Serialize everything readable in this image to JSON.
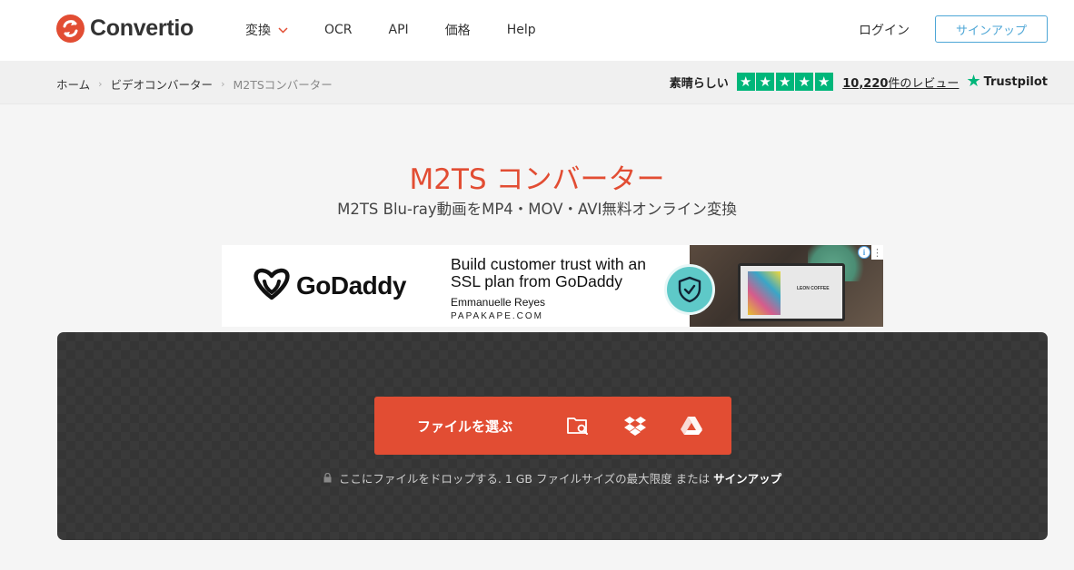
{
  "header": {
    "logo_text": "Convertio",
    "nav": [
      {
        "label": "変換",
        "has_dropdown": true
      },
      {
        "label": "OCR"
      },
      {
        "label": "API"
      },
      {
        "label": "価格"
      },
      {
        "label": "Help"
      }
    ],
    "login": "ログイン",
    "signup": "サインアップ"
  },
  "breadcrumb": {
    "items": [
      "ホーム",
      "ビデオコンバーター",
      "M2TSコンバーター"
    ],
    "separator": "›"
  },
  "trustpilot": {
    "label": "素晴らしい",
    "rating_stars": 5,
    "reviews_count": "10,220",
    "reviews_suffix": "件のレビュー",
    "brand": "Trustpilot",
    "star_color": "#00b67a"
  },
  "main": {
    "title": "M2TS コンバーター",
    "subtitle": "M2TS Blu-ray動画をMP4・MOV・AVI無料オンライン変換"
  },
  "ad": {
    "brand": "GoDaddy",
    "headline": "Build customer trust with an SSL plan from GoDaddy",
    "person": "Emmanuelle Reyes",
    "site": "PAPAKAPE.COM",
    "photo_text": "LEON COFFEE",
    "info_icon": "i"
  },
  "upload": {
    "choose_label": "ファイルを選ぶ",
    "sources": [
      "folder-search-icon",
      "dropbox-icon",
      "google-drive-icon"
    ],
    "note_prefix": "ここにファイルをドロップする. 1 GB ファイルサイズの最大限度 または",
    "note_link": "サインアップ"
  },
  "colors": {
    "accent": "#e24d33",
    "signup_border": "#4da6d6",
    "upload_bg": "#3a3a3a"
  }
}
